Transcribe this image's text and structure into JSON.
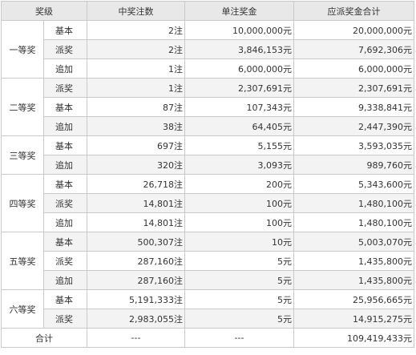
{
  "headers": [
    "奖级",
    "中奖注数",
    "单注奖金",
    "应派奖金合计"
  ],
  "levels": [
    {
      "name": "一等奖",
      "rows": [
        {
          "type": "基本",
          "count": "2注",
          "prize": "10,000,000元",
          "total": "20,000,000元"
        },
        {
          "type": "派奖",
          "count": "2注",
          "prize": "3,846,153元",
          "total": "7,692,306元"
        },
        {
          "type": "追加",
          "count": "1注",
          "prize": "6,000,000元",
          "total": "6,000,000元"
        }
      ]
    },
    {
      "name": "二等奖",
      "rows": [
        {
          "type": "派奖",
          "count": "1注",
          "prize": "2,307,691元",
          "total": "2,307,691元"
        },
        {
          "type": "基本",
          "count": "87注",
          "prize": "107,343元",
          "total": "9,338,841元"
        },
        {
          "type": "追加",
          "count": "38注",
          "prize": "64,405元",
          "total": "2,447,390元"
        }
      ]
    },
    {
      "name": "三等奖",
      "rows": [
        {
          "type": "基本",
          "count": "697注",
          "prize": "5,155元",
          "total": "3,593,035元"
        },
        {
          "type": "追加",
          "count": "320注",
          "prize": "3,093元",
          "total": "989,760元"
        }
      ]
    },
    {
      "name": "四等奖",
      "rows": [
        {
          "type": "基本",
          "count": "26,718注",
          "prize": "200元",
          "total": "5,343,600元"
        },
        {
          "type": "派奖",
          "count": "14,801注",
          "prize": "100元",
          "total": "1,480,100元"
        },
        {
          "type": "追加",
          "count": "14,801注",
          "prize": "100元",
          "total": "1,480,100元"
        }
      ]
    },
    {
      "name": "五等奖",
      "rows": [
        {
          "type": "基本",
          "count": "500,307注",
          "prize": "10元",
          "total": "5,003,070元"
        },
        {
          "type": "派奖",
          "count": "287,160注",
          "prize": "5元",
          "total": "1,435,800元"
        },
        {
          "type": "追加",
          "count": "287,160注",
          "prize": "5元",
          "total": "1,435,800元"
        }
      ]
    },
    {
      "name": "六等奖",
      "rows": [
        {
          "type": "基本",
          "count": "5,191,333注",
          "prize": "5元",
          "total": "25,956,665元"
        },
        {
          "type": "派奖",
          "count": "2,983,055注",
          "prize": "5元",
          "total": "14,915,275元"
        }
      ]
    }
  ],
  "footer": {
    "label": "合计",
    "count": "---",
    "prize": "---",
    "total": "109,419,433元"
  }
}
